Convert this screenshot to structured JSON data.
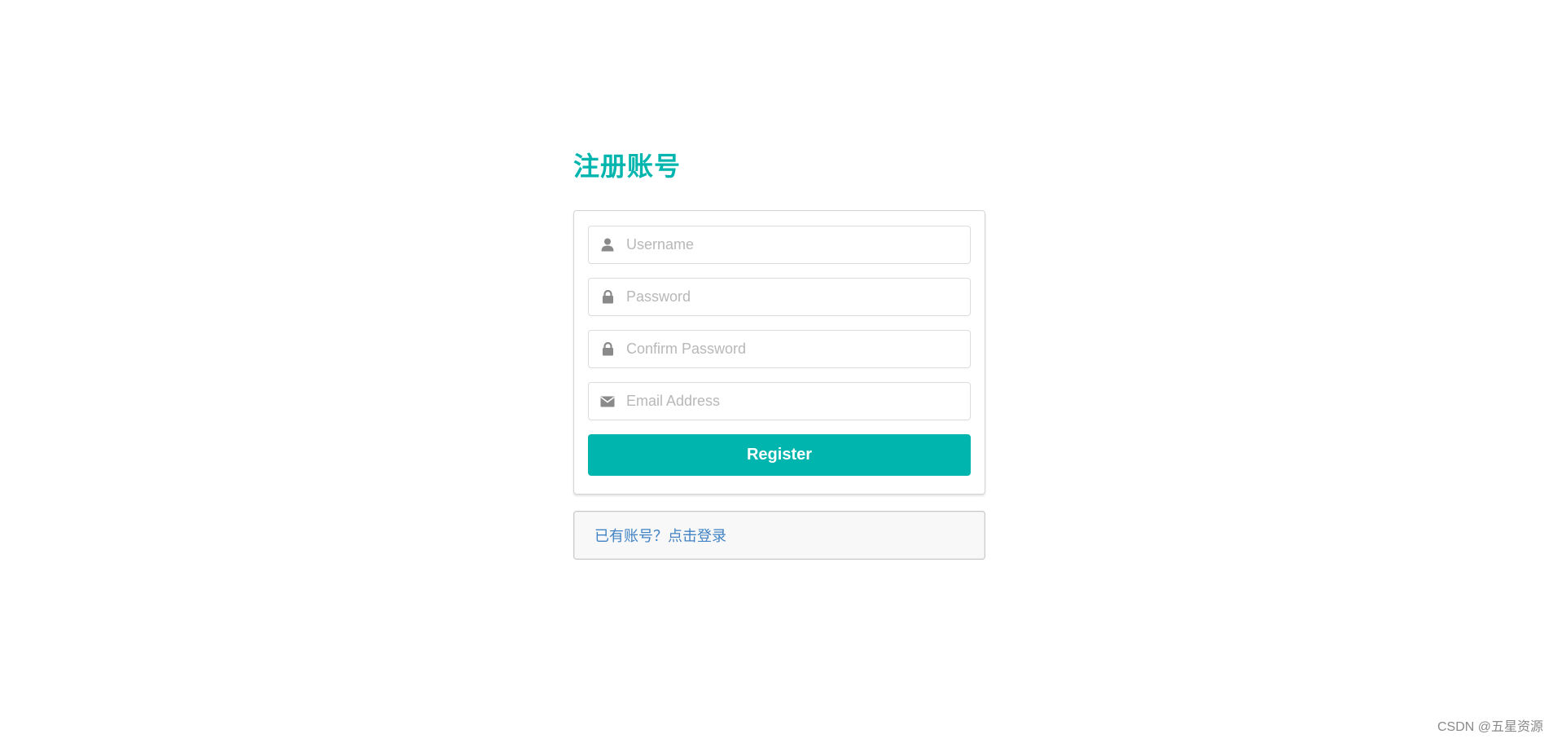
{
  "title": "注册账号",
  "form": {
    "username": {
      "placeholder": "Username",
      "icon": "user-icon"
    },
    "password": {
      "placeholder": "Password",
      "icon": "lock-icon"
    },
    "confirm_password": {
      "placeholder": "Confirm Password",
      "icon": "lock-icon"
    },
    "email": {
      "placeholder": "Email Address",
      "icon": "envelope-icon"
    },
    "register_label": "Register"
  },
  "login_prompt": "已有账号？点击登录",
  "watermark": "CSDN @五星资源",
  "colors": {
    "accent": "#00b5ad",
    "link": "#4183c4",
    "icon": "#8a8a8a"
  }
}
